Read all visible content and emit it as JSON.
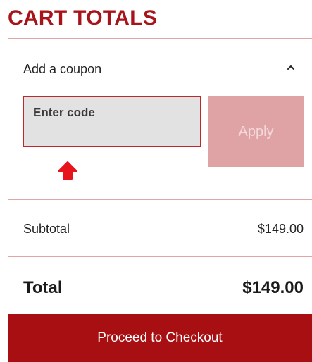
{
  "cart_totals": {
    "heading": "CART TOTALS",
    "coupon": {
      "toggle_label": "Add a coupon",
      "expanded": true,
      "input_placeholder": "Enter code",
      "input_value": "",
      "apply_label": "Apply",
      "apply_disabled": true
    },
    "subtotal": {
      "label": "Subtotal",
      "value": "$149.00"
    },
    "total": {
      "label": "Total",
      "value": "$149.00"
    },
    "checkout_label": "Proceed to Checkout"
  },
  "icons": {
    "chevron": "chevron-up-icon",
    "indicator": "arrow-up-icon"
  },
  "colors": {
    "brand": "#a8131a",
    "checkout_button": "#a80f12",
    "apply_disabled": "#dfa3a6",
    "divider": "#e3a4a8",
    "input_background": "#e2e2e2",
    "indicator_arrow": "#e8141c"
  }
}
